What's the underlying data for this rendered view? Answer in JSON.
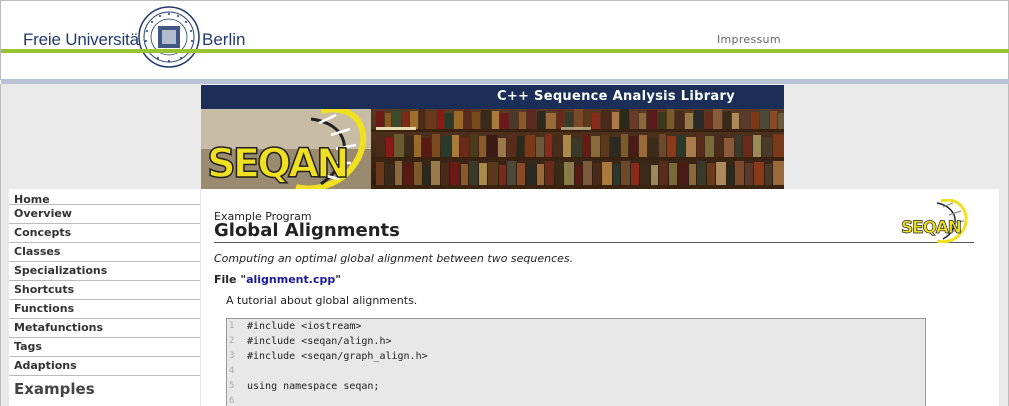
{
  "header": {
    "university_left": "Freie Universität",
    "university_right": "Berlin",
    "impressum": "Impressum",
    "colors": {
      "green": "#99c235",
      "blue_bar": "#b8c4d6",
      "navy": "#1b2e57"
    }
  },
  "banner": {
    "title": "C++ Sequence Analysis Library",
    "logo_text": "SEQAN"
  },
  "sidebar": {
    "items": [
      {
        "label": "Home"
      },
      {
        "label": "Overview"
      },
      {
        "label": "Concepts"
      },
      {
        "label": "Classes"
      },
      {
        "label": "Specializations"
      },
      {
        "label": "Shortcuts"
      },
      {
        "label": "Functions"
      },
      {
        "label": "Metafunctions"
      },
      {
        "label": "Tags"
      },
      {
        "label": "Adaptions"
      },
      {
        "label": "Examples"
      }
    ]
  },
  "main": {
    "kicker": "Example Program",
    "title": "Global Alignments",
    "description": "Computing an optimal global alignment between two sequences.",
    "file_prefix": "File \"",
    "file_name": "alignment.cpp",
    "file_suffix": "\"",
    "tutorial": "A tutorial about global alignments.",
    "code_lines": [
      {
        "n": "1",
        "text": "#include <iostream>"
      },
      {
        "n": "2",
        "text": "#include <seqan/align.h>"
      },
      {
        "n": "3",
        "text": "#include <seqan/graph_align.h>"
      },
      {
        "n": "4",
        "text": ""
      },
      {
        "n": "5",
        "text": "using namespace seqan;"
      },
      {
        "n": "6",
        "text": ""
      }
    ]
  }
}
